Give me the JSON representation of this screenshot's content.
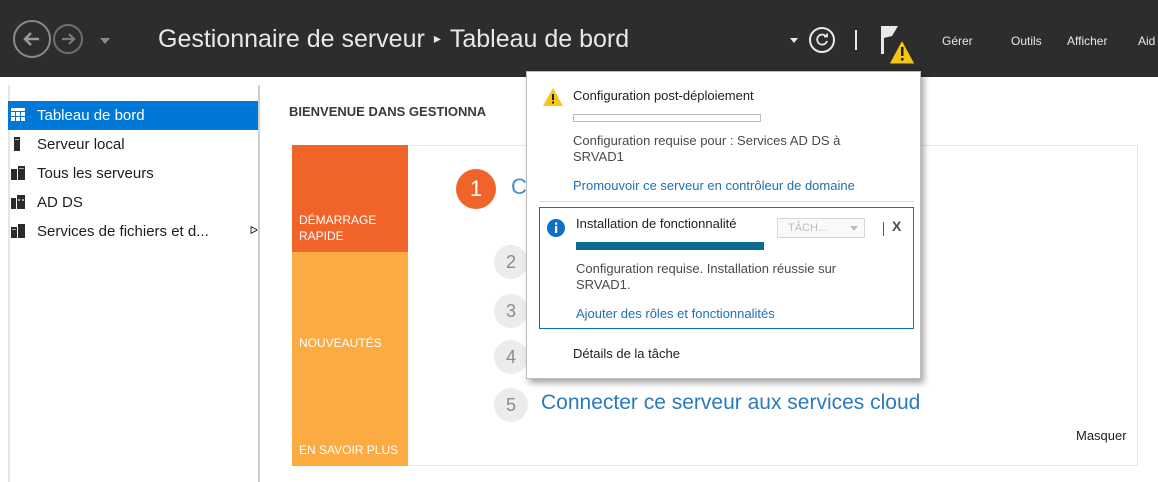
{
  "header": {
    "title": "Gestionnaire de serveur",
    "separator": "▸",
    "breadcrumb": "Tableau de bord",
    "menus": [
      "Gérer",
      "Outils",
      "Afficher",
      "Aid"
    ]
  },
  "sidebar": {
    "items": [
      {
        "label": "Tableau de bord",
        "icon": "dashboard-icon"
      },
      {
        "label": "Serveur local",
        "icon": "server-icon"
      },
      {
        "label": "Tous les serveurs",
        "icon": "servers-icon"
      },
      {
        "label": "AD DS",
        "icon": "ad-ds-icon"
      },
      {
        "label": "Services de fichiers et d...",
        "icon": "file-services-icon"
      }
    ],
    "expand_arrow": "ᐅ"
  },
  "main": {
    "welcome": "BIENVENUE DANS GESTIONNA",
    "tiles": [
      "DÉMARRAGE RAPIDE",
      "NOUVEAUTÉS",
      "EN SAVOIR PLUS"
    ],
    "step1_number": "1",
    "step1_partial": "C",
    "steps": [
      "2",
      "3",
      "4",
      "5"
    ],
    "step5_text": "Connecter ce serveur aux services cloud",
    "hide_label": "Masquer"
  },
  "popup": {
    "notif1": {
      "title": "Configuration post-déploiement",
      "progress": 0,
      "description": "Configuration requise pour : Services AD DS à SRVAD1",
      "link": "Promouvoir ce serveur en contrôleur de domaine"
    },
    "notif2": {
      "title": "Installation de fonctionnalité",
      "tasks_dropdown": "TÂCH...",
      "close": "X",
      "progress": 1,
      "description": "Configuration requise. Installation réussie sur SRVAD1.",
      "link": "Ajouter des rôles et fonctionnalités"
    },
    "task_details": "Détails de la tâche"
  },
  "colors": {
    "accent": "#0078d7",
    "tile_orange": "#f0642a",
    "tile_yellow": "#fbab41",
    "link": "#1f6fb5",
    "warning": "#f5c518"
  }
}
